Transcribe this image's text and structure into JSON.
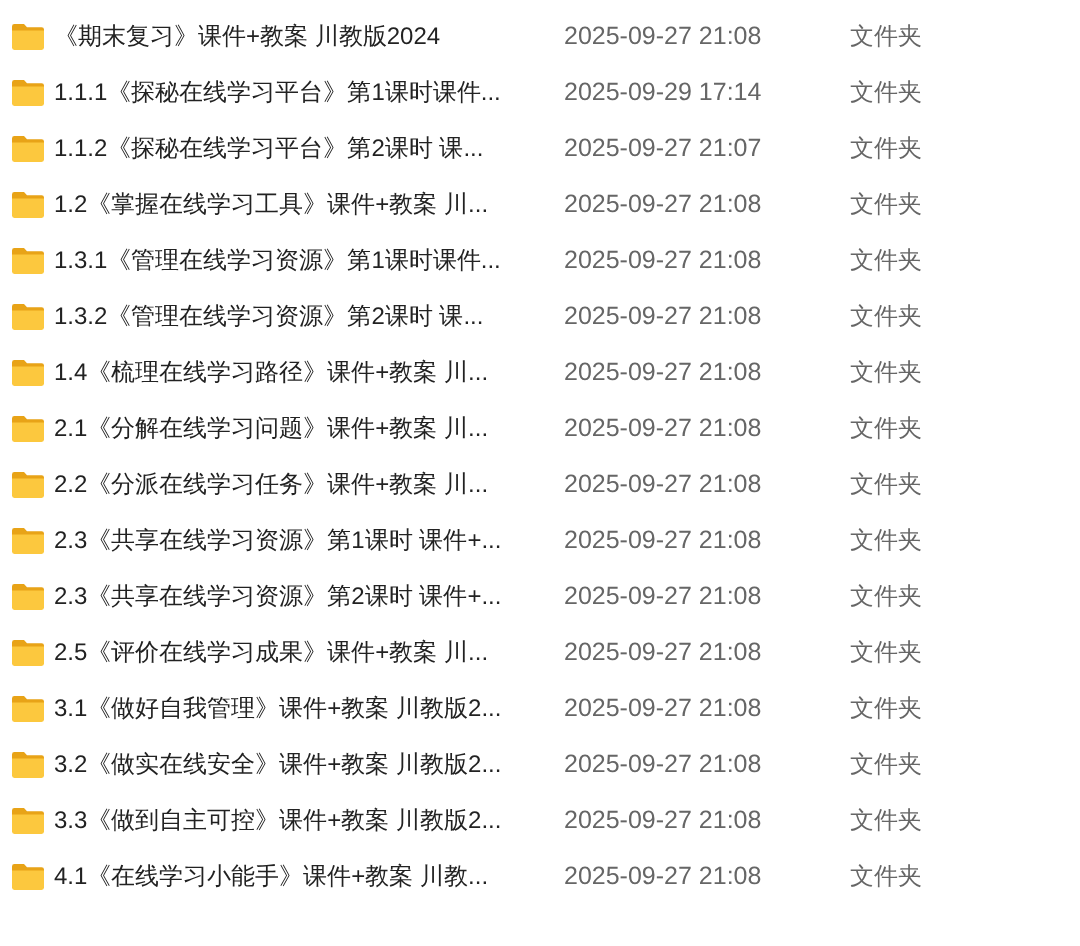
{
  "files": [
    {
      "name": "《期末复习》课件+教案 川教版2024",
      "modified": "2025-09-27 21:08",
      "type": "文件夹"
    },
    {
      "name": "1.1.1《探秘在线学习平台》第1课时课件...",
      "modified": "2025-09-29 17:14",
      "type": "文件夹"
    },
    {
      "name": "1.1.2《探秘在线学习平台》第2课时 课...",
      "modified": "2025-09-27 21:07",
      "type": "文件夹"
    },
    {
      "name": "1.2《掌握在线学习工具》课件+教案 川...",
      "modified": "2025-09-27 21:08",
      "type": "文件夹"
    },
    {
      "name": "1.3.1《管理在线学习资源》第1课时课件...",
      "modified": "2025-09-27 21:08",
      "type": "文件夹"
    },
    {
      "name": "1.3.2《管理在线学习资源》第2课时 课...",
      "modified": "2025-09-27 21:08",
      "type": "文件夹"
    },
    {
      "name": "1.4《梳理在线学习路径》课件+教案 川...",
      "modified": "2025-09-27 21:08",
      "type": "文件夹"
    },
    {
      "name": "2.1《分解在线学习问题》课件+教案 川...",
      "modified": "2025-09-27 21:08",
      "type": "文件夹"
    },
    {
      "name": "2.2《分派在线学习任务》课件+教案 川...",
      "modified": "2025-09-27 21:08",
      "type": "文件夹"
    },
    {
      "name": "2.3《共享在线学习资源》第1课时 课件+...",
      "modified": "2025-09-27 21:08",
      "type": "文件夹"
    },
    {
      "name": "2.3《共享在线学习资源》第2课时 课件+...",
      "modified": "2025-09-27 21:08",
      "type": "文件夹"
    },
    {
      "name": "2.5《评价在线学习成果》课件+教案 川...",
      "modified": "2025-09-27 21:08",
      "type": "文件夹"
    },
    {
      "name": "3.1《做好自我管理》课件+教案 川教版2...",
      "modified": "2025-09-27 21:08",
      "type": "文件夹"
    },
    {
      "name": "3.2《做实在线安全》课件+教案 川教版2...",
      "modified": "2025-09-27 21:08",
      "type": "文件夹"
    },
    {
      "name": "3.3《做到自主可控》课件+教案 川教版2...",
      "modified": "2025-09-27 21:08",
      "type": "文件夹"
    },
    {
      "name": "4.1《在线学习小能手》课件+教案 川教...",
      "modified": "2025-09-27 21:08",
      "type": "文件夹"
    }
  ]
}
